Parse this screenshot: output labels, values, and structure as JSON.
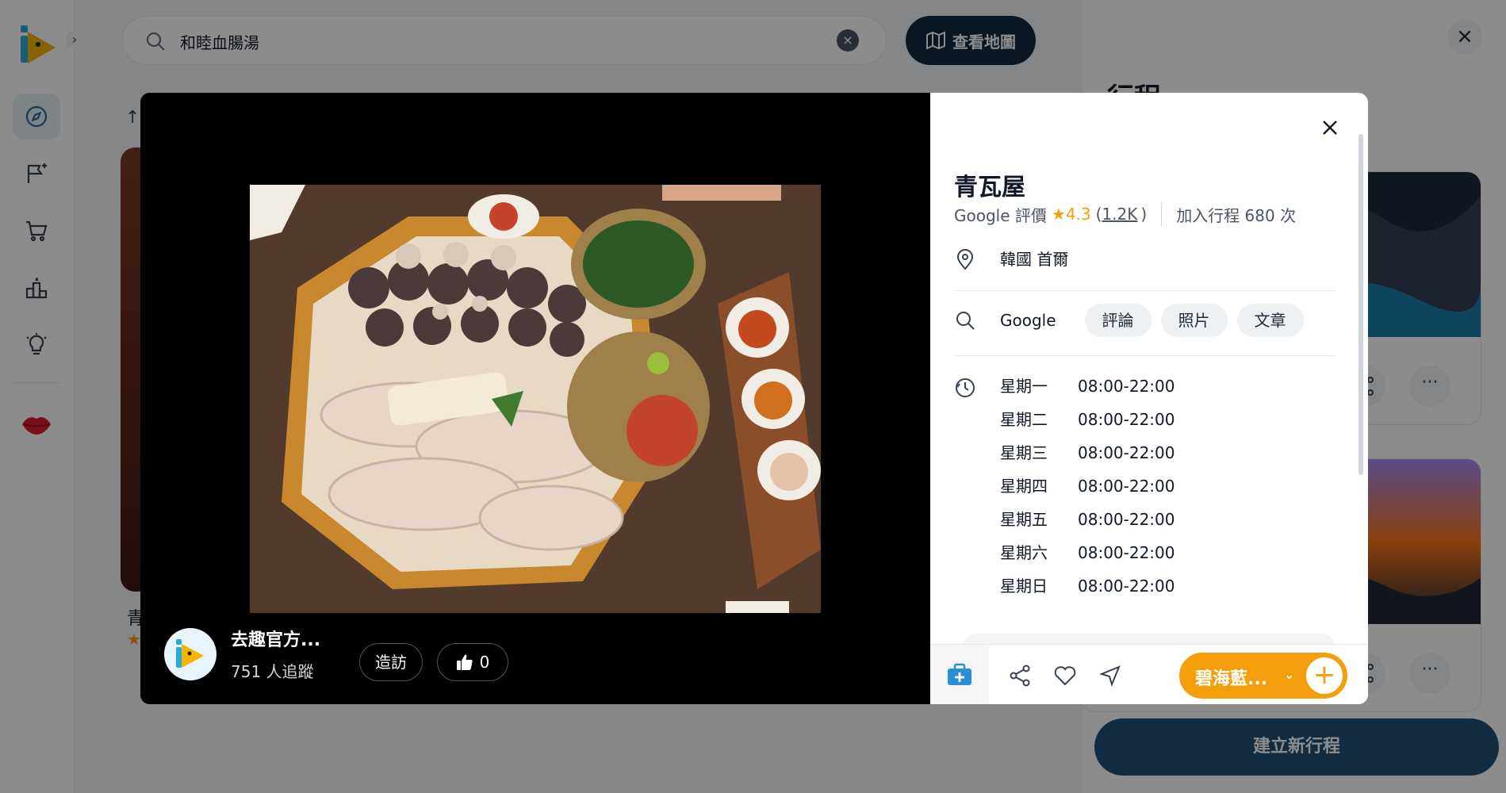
{
  "search": {
    "query": "和睦血腸湯"
  },
  "header": {
    "map_button": "查看地圖"
  },
  "sidebar": {
    "expand": "›",
    "items": [
      {
        "icon": "compass-icon",
        "active": true
      },
      {
        "icon": "flag-add-icon",
        "active": false
      },
      {
        "icon": "cart-icon",
        "active": false
      },
      {
        "icon": "podium-icon",
        "active": false
      },
      {
        "icon": "lightbulb-icon",
        "active": false
      }
    ]
  },
  "background_list": {
    "sort_glyph": "↑",
    "first_title": "青",
    "first_rating": "★"
  },
  "right_panel": {
    "title": "行程",
    "create_button": "建立新行程"
  },
  "modal": {
    "author": {
      "name": "去趣官方...",
      "followers": "751 人追蹤",
      "visit_button": "造訪",
      "likes": "0"
    },
    "place": {
      "name": "青瓦屋",
      "rating_label": "Google 評價",
      "rating_star": "★",
      "rating_score": "4.3",
      "rating_open": "(",
      "rating_count": "1.2K",
      "rating_close": ")",
      "added_label": "加入行程 680 次",
      "location": "韓國 首爾"
    },
    "search_links": {
      "label": "Google",
      "chips": [
        "評論",
        "照片",
        "文章"
      ]
    },
    "hours": [
      {
        "day": "星期一",
        "time": "08:00-22:00"
      },
      {
        "day": "星期二",
        "time": "08:00-22:00"
      },
      {
        "day": "星期三",
        "time": "08:00-22:00"
      },
      {
        "day": "星期四",
        "time": "08:00-22:00"
      },
      {
        "day": "星期五",
        "time": "08:00-22:00"
      },
      {
        "day": "星期六",
        "time": "08:00-22:00"
      },
      {
        "day": "星期日",
        "time": "08:00-22:00"
      }
    ],
    "action_bar": {
      "trip_name": "碧海藍...",
      "chevron": "⌄",
      "plus": "+"
    }
  },
  "colors": {
    "accent_orange": "#f59e0b",
    "navy": "#0f2a3e",
    "create_blue": "#1f4f75"
  }
}
